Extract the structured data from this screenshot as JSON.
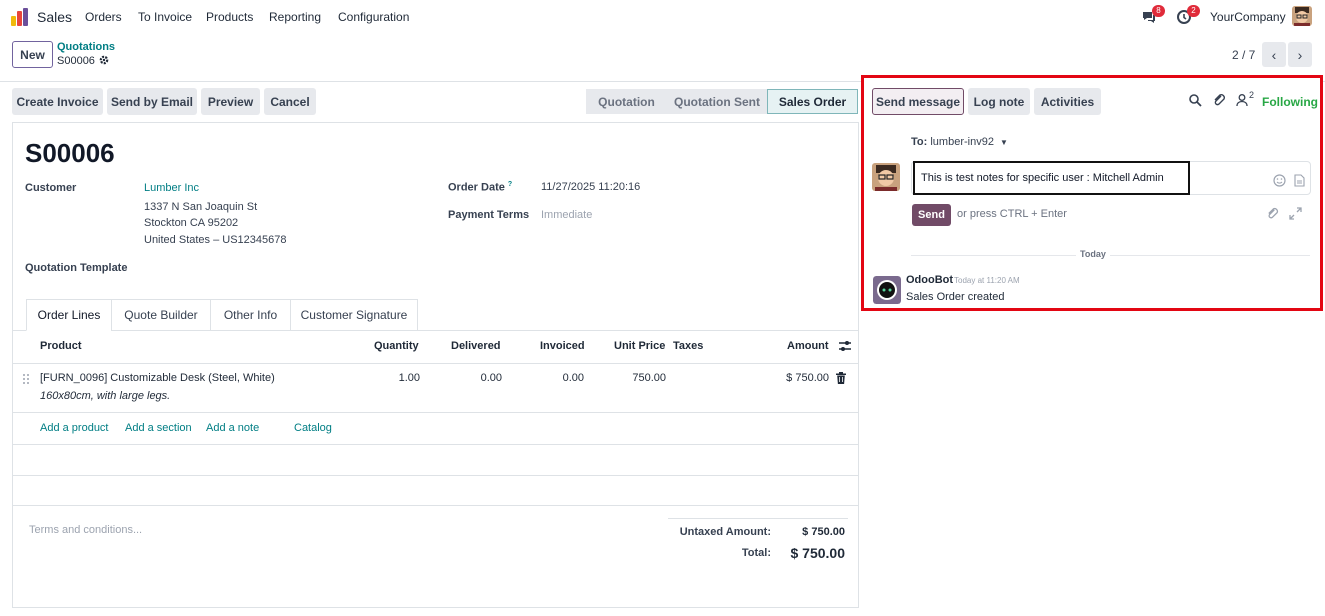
{
  "navbar": {
    "app_name": "Sales",
    "menu": [
      "Orders",
      "To Invoice",
      "Products",
      "Reporting",
      "Configuration"
    ],
    "messages_count": "8",
    "activities_count": "2",
    "company": "YourCompany"
  },
  "control": {
    "new_label": "New",
    "breadcrumb_parent": "Quotations",
    "breadcrumb_record": "S00006",
    "pager": "2 / 7"
  },
  "actions": [
    "Create Invoice",
    "Send by Email",
    "Preview",
    "Cancel"
  ],
  "stages": [
    "Quotation",
    "Quotation Sent",
    "Sales Order"
  ],
  "form": {
    "title": "S00006",
    "customer_label": "Customer",
    "customer_name": "Lumber Inc",
    "address": [
      "1337 N San Joaquin St",
      "Stockton CA 95202",
      "United States – US12345678"
    ],
    "template_label": "Quotation Template",
    "order_date_label": "Order Date",
    "order_date_help": "?",
    "order_date": "11/27/2025 11:20:16",
    "payment_terms_label": "Payment Terms",
    "payment_terms": "Immediate"
  },
  "tabs": [
    "Order Lines",
    "Quote Builder",
    "Other Info",
    "Customer Signature"
  ],
  "table": {
    "headers": {
      "product": "Product",
      "quantity": "Quantity",
      "delivered": "Delivered",
      "invoiced": "Invoiced",
      "unit_price": "Unit Price",
      "taxes": "Taxes",
      "amount": "Amount"
    },
    "rows": [
      {
        "product": "[FURN_0096] Customizable Desk (Steel, White)",
        "description": "160x80cm, with large legs.",
        "quantity": "1.00",
        "delivered": "0.00",
        "invoiced": "0.00",
        "unit_price": "750.00",
        "amount": "$ 750.00"
      }
    ],
    "add_links": [
      "Add a product",
      "Add a section",
      "Add a note",
      "Catalog"
    ]
  },
  "totals": {
    "terms_placeholder": "Terms and conditions...",
    "untaxed_label": "Untaxed Amount:",
    "untaxed_value": "$ 750.00",
    "total_label": "Total:",
    "total_value": "$ 750.00"
  },
  "chatter": {
    "send_message": "Send message",
    "log_note": "Log note",
    "activities": "Activities",
    "followers_count": "2",
    "following": "Following",
    "to_label": "To:",
    "to_value": "lumber-inv92",
    "composer_text": "This is test notes for specific user : Mitchell Admin",
    "send": "Send",
    "hint": "or press CTRL + Enter",
    "today": "Today",
    "message": {
      "author": "OdooBot",
      "date": "Today at 11:20 AM",
      "body": "Sales Order created"
    }
  },
  "colors": {
    "brand": "#714b67",
    "link": "#017e84",
    "highlight_border": "#e30613",
    "following": "#28a745"
  }
}
